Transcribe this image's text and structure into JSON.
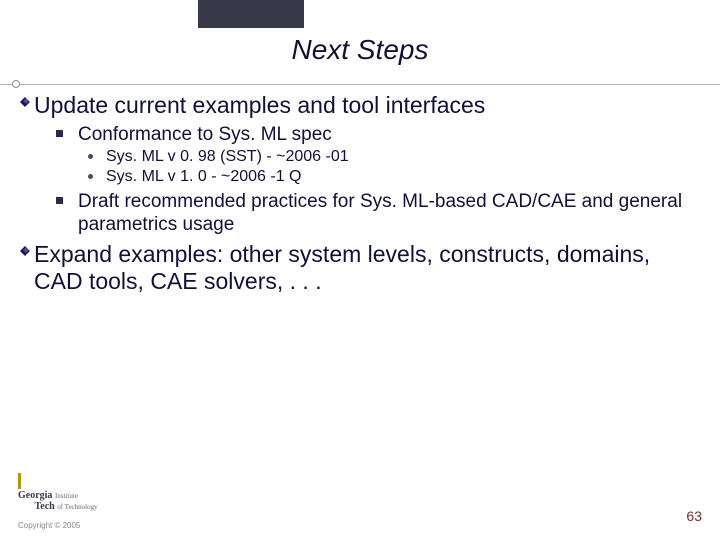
{
  "title": "Next Steps",
  "bullets": {
    "b1": "Update current examples and tool interfaces",
    "b1a": "Conformance to Sys. ML spec",
    "b1a1": "Sys. ML v 0. 98 (SST) - ~2006 -01",
    "b1a2": "Sys. ML v 1. 0 - ~2006 -1 Q",
    "b1b": "Draft recommended practices for Sys. ML-based CAD/CAE and general parametrics usage",
    "b2": "Expand examples: other system levels, constructs, domains, CAD tools, CAE solvers, . . ."
  },
  "logo": {
    "line1a": "Georgia",
    "line1b": "Institute",
    "line2a": "Tech",
    "line2b": "of Technology"
  },
  "footer": {
    "copyright": "Copyright © 2005",
    "page": "63"
  }
}
